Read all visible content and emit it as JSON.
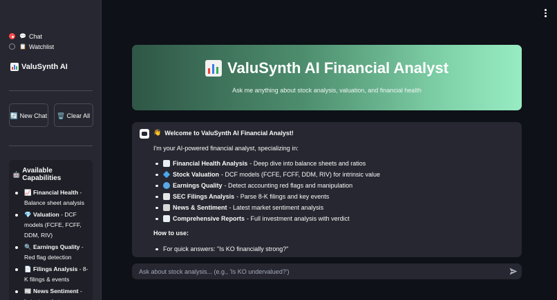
{
  "sidebar": {
    "nav": [
      {
        "icon": "speech-bubble-icon",
        "label": "Chat",
        "selected": true
      },
      {
        "icon": "clipboard-icon",
        "label": "Watchlist",
        "selected": false
      }
    ],
    "app_title": "ValuSynth AI",
    "buttons": {
      "new_chat": "New Chat",
      "clear_all": "Clear All"
    },
    "capabilities": {
      "title": "Available Capabilities",
      "items": [
        {
          "icon": "chart-up-icon",
          "name": "Financial Health",
          "desc": " - Balance sheet analysis"
        },
        {
          "icon": "gem-icon",
          "name": "Valuation",
          "desc": " - DCF models (FCFE, FCFF, DDM, RIV)"
        },
        {
          "icon": "magnifier-icon",
          "name": "Earnings Quality",
          "desc": " - Red flag detection"
        },
        {
          "icon": "document-icon",
          "name": "Filings Analysis",
          "desc": " - 8-K filings & events"
        },
        {
          "icon": "newspaper-icon",
          "name": "News Sentiment",
          "desc": " - Latest market news"
        }
      ]
    }
  },
  "hero": {
    "title": "ValuSynth AI Financial Analyst",
    "subtitle": "Ask me anything about stock analysis, valuation, and financial health"
  },
  "chat": {
    "welcome": "Welcome to ValuSynth AI Financial Analyst!",
    "intro": "I'm your AI-powered financial analyst, specializing in:",
    "features": [
      {
        "icon": "chart-up-icon",
        "color": "#e9eef5",
        "name": "Financial Health Analysis",
        "desc": "- Deep dive into balance sheets and ratios"
      },
      {
        "icon": "gem-icon",
        "color": "#49a7e8",
        "name": "Stock Valuation",
        "desc": "- DCF models (FCFE, FCFF, DDM, RIV) for intrinsic value"
      },
      {
        "icon": "magnifier-icon",
        "color": "#5aa6e6",
        "name": "Earnings Quality",
        "desc": "- Detect accounting red flags and manipulation"
      },
      {
        "icon": "document-icon",
        "color": "#e6e6e6",
        "name": "SEC Filings Analysis",
        "desc": "- Parse 8-K filings and key events"
      },
      {
        "icon": "newspaper-icon",
        "color": "#d8d8d8",
        "name": "News & Sentiment",
        "desc": "- Latest market sentiment analysis"
      },
      {
        "icon": "bar-chart-icon",
        "color": "#e9eef5",
        "name": "Comprehensive Reports",
        "desc": "- Full investment analysis with verdict"
      }
    ],
    "howto_title": "How to use:",
    "howto_items": [
      "For quick answers: \"Is KO financially strong?\""
    ]
  },
  "input": {
    "placeholder": "Ask about stock analysis... (e.g., 'Is KO undervalued?')"
  },
  "colors": {
    "accent": "#ff4b4b",
    "background": "#0e1117",
    "sidebar": "#262730"
  }
}
